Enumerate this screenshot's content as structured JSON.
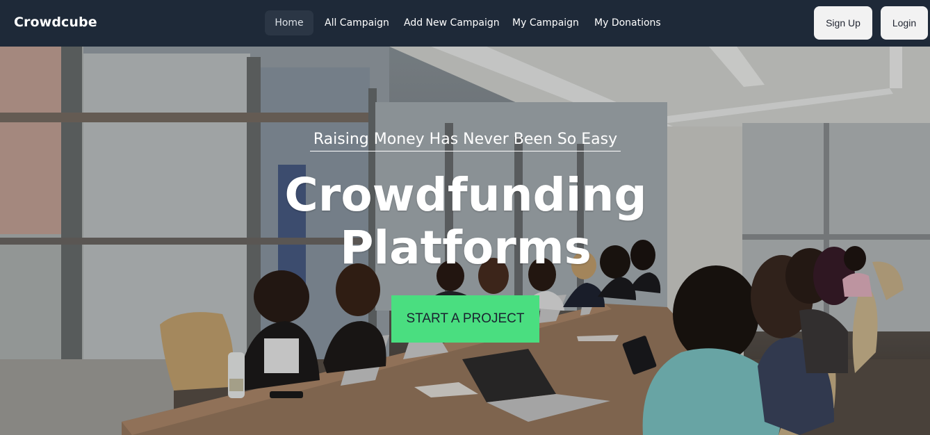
{
  "navbar": {
    "brand": "Crowdcube",
    "links": [
      {
        "label": "Home",
        "active": true
      },
      {
        "label": "All Campaign",
        "active": false
      },
      {
        "label": "Add New Campaign",
        "active": false
      },
      {
        "label": "My Campaign",
        "active": false
      },
      {
        "label": "My Donations",
        "active": false
      }
    ],
    "signup_label": "Sign Up",
    "login_label": "Login"
  },
  "hero": {
    "tagline": "Raising Money Has Never Been So Easy",
    "title_line1": "Crowdfunding",
    "title_line2": "Platforms",
    "cta_label": "START A PROJECT",
    "background_image": "meeting-room-photo"
  },
  "colors": {
    "navbar_bg": "#1e2938",
    "cta_bg": "#4ade80",
    "button_bg": "#f2f2f2"
  }
}
